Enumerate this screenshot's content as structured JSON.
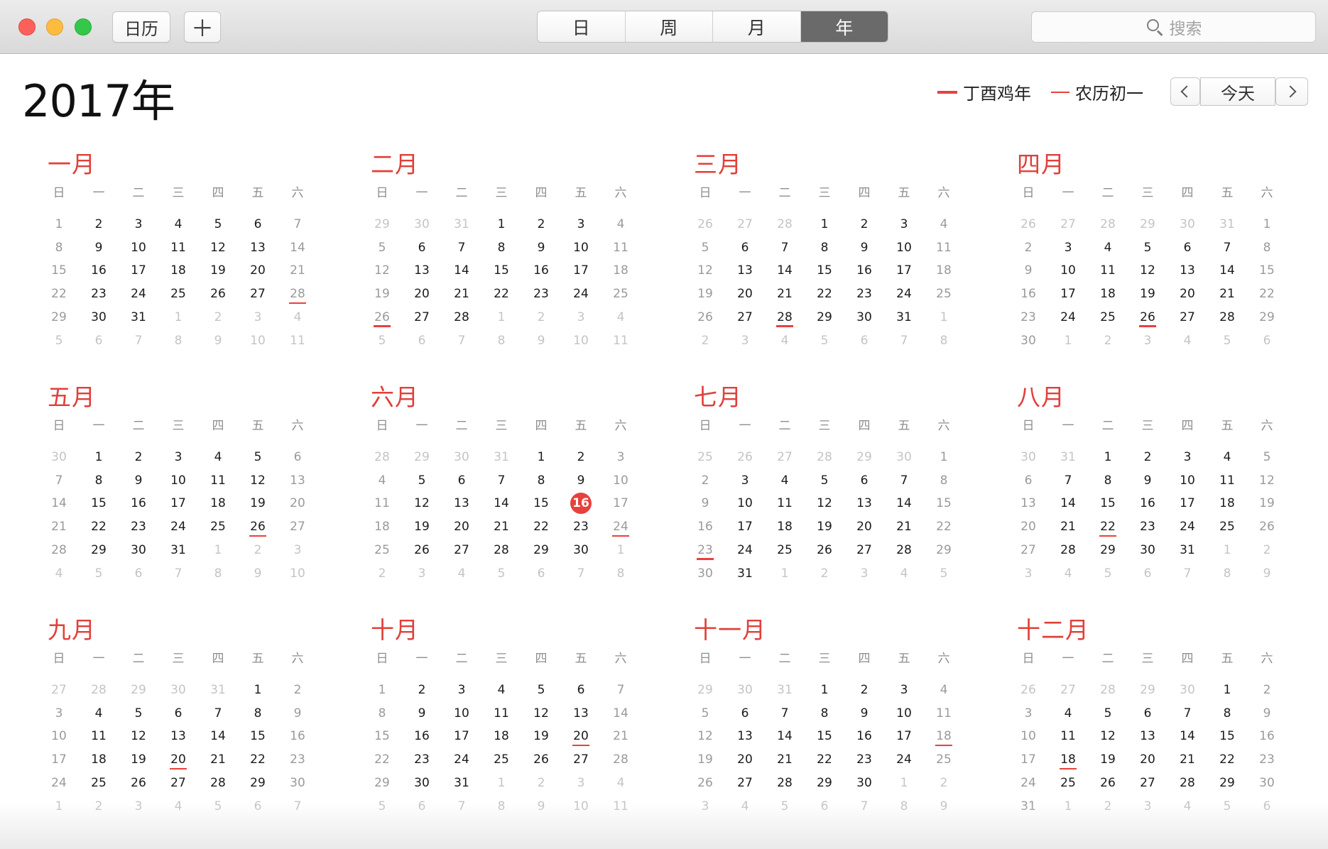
{
  "toolbar": {
    "calendars_label": "日历",
    "add_label": "＋",
    "views": [
      "日",
      "周",
      "月",
      "年"
    ],
    "active_view": "年",
    "search_placeholder": "搜索"
  },
  "header": {
    "year_title": "2017年",
    "legend_ganzhi": "丁酉鸡年",
    "legend_lunar": "农历初一",
    "today_label": "今天"
  },
  "colors": {
    "accent": "#e0403a",
    "today": "#e8413c"
  },
  "dow_labels": [
    "日",
    "一",
    "二",
    "三",
    "四",
    "五",
    "六"
  ],
  "months": [
    {
      "name": "一月",
      "first_dow": 0,
      "days": 31,
      "prev_days": 31,
      "holidays": [
        28
      ],
      "today": null
    },
    {
      "name": "二月",
      "first_dow": 3,
      "days": 28,
      "prev_days": 31,
      "holidays": [
        26
      ],
      "today": null
    },
    {
      "name": "三月",
      "first_dow": 3,
      "days": 31,
      "prev_days": 28,
      "holidays": [
        28
      ],
      "today": null
    },
    {
      "name": "四月",
      "first_dow": 6,
      "days": 30,
      "prev_days": 31,
      "holidays": [
        26
      ],
      "today": null
    },
    {
      "name": "五月",
      "first_dow": 1,
      "days": 31,
      "prev_days": 30,
      "holidays": [
        26
      ],
      "today": null
    },
    {
      "name": "六月",
      "first_dow": 4,
      "days": 30,
      "prev_days": 31,
      "holidays": [
        24
      ],
      "today": 16
    },
    {
      "name": "七月",
      "first_dow": 6,
      "days": 31,
      "prev_days": 30,
      "holidays": [
        23
      ],
      "today": null
    },
    {
      "name": "八月",
      "first_dow": 2,
      "days": 31,
      "prev_days": 31,
      "holidays": [
        22
      ],
      "today": null
    },
    {
      "name": "九月",
      "first_dow": 5,
      "days": 30,
      "prev_days": 31,
      "holidays": [
        20
      ],
      "today": null
    },
    {
      "name": "十月",
      "first_dow": 0,
      "days": 31,
      "prev_days": 30,
      "holidays": [
        20
      ],
      "today": null
    },
    {
      "name": "十一月",
      "first_dow": 3,
      "days": 30,
      "prev_days": 31,
      "holidays": [
        18
      ],
      "today": null
    },
    {
      "name": "十二月",
      "first_dow": 5,
      "days": 31,
      "prev_days": 30,
      "holidays": [
        18
      ],
      "today": null
    }
  ]
}
